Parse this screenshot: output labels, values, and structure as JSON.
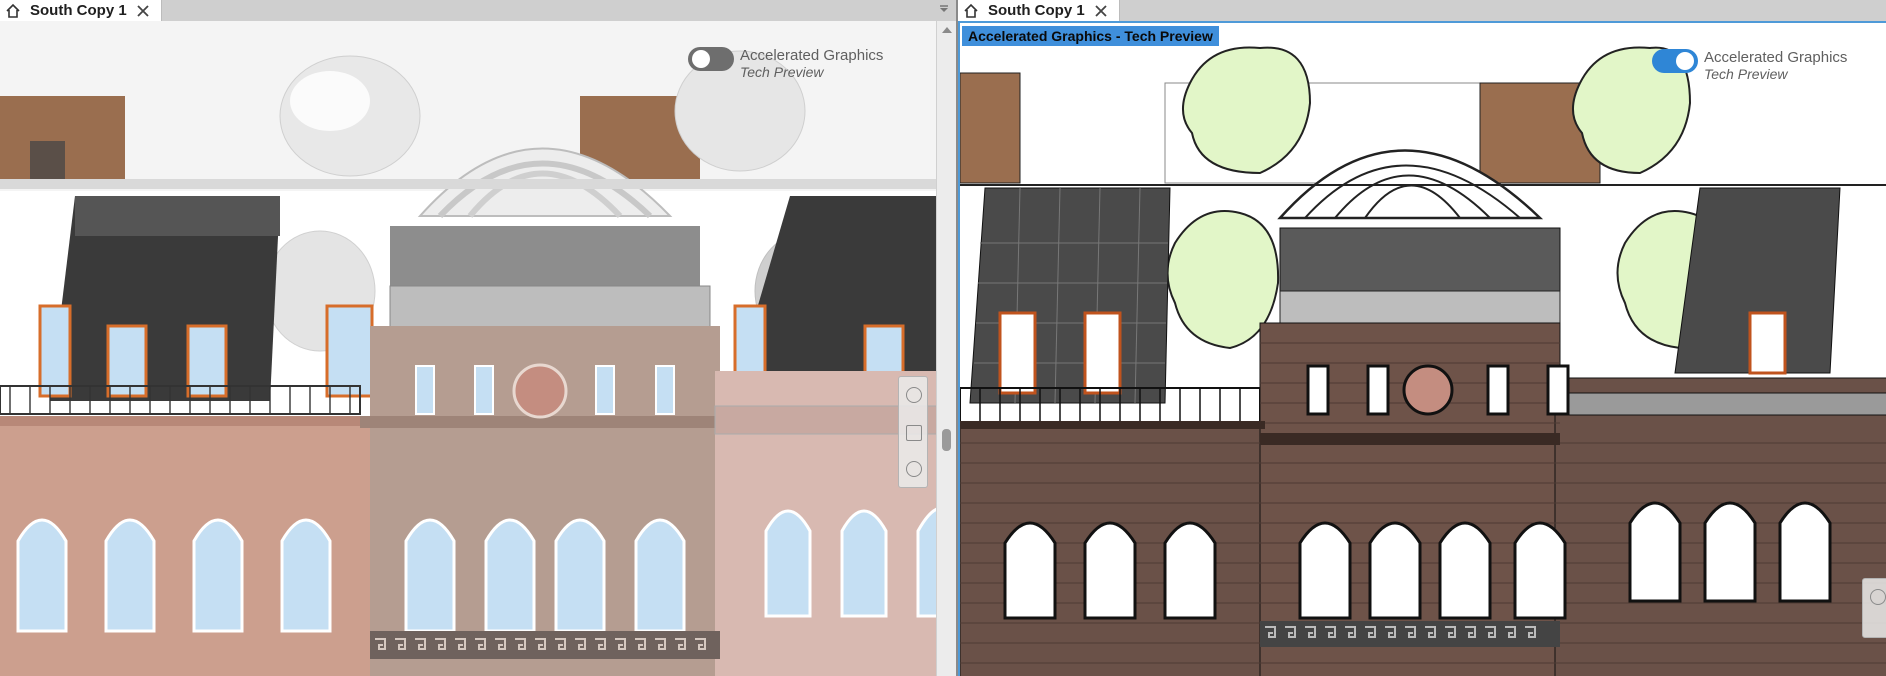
{
  "left_pane": {
    "tab_title": "South Copy 1",
    "accelerated_graphics_label": "Accelerated Graphics",
    "tech_preview_label": "Tech Preview",
    "toggle_state": "off"
  },
  "right_pane": {
    "tab_title": "South Copy 1",
    "view_badge": "Accelerated Graphics - Tech Preview",
    "accelerated_graphics_label": "Accelerated Graphics",
    "tech_preview_label": "Tech Preview",
    "toggle_state": "on"
  },
  "icons": {
    "home": "home-icon",
    "close": "close-icon",
    "tab_menu": "chevron-down-icon",
    "navigation_bar": "navigation-bar-icon"
  },
  "colors": {
    "accent_blue": "#3f8fdb",
    "toggle_off": "#6e6e6e",
    "toggle_on": "#2f86d6",
    "left_left_building": "#cc9f8e",
    "left_center_building": "#b59d91",
    "left_right_building": "#d8b9b1",
    "right_brick": "#6a5148",
    "tree_fill": "#e2f6c8"
  }
}
